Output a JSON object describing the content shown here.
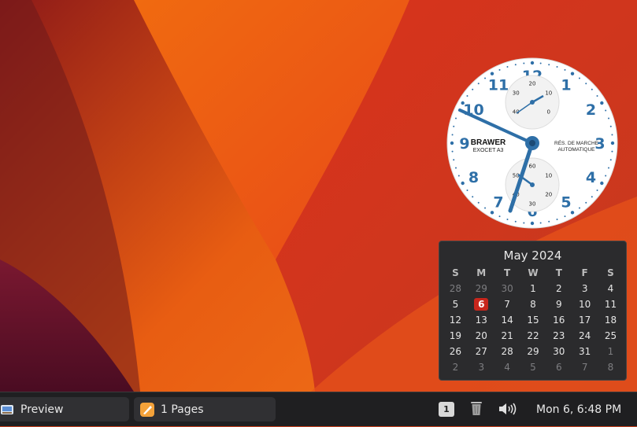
{
  "wallpaper": {
    "colors": [
      "#9a1e1a",
      "#f06b10",
      "#d8401c",
      "#6e1230"
    ]
  },
  "clock_widget": {
    "brand": "BRAWER",
    "model": "EXOCET A3",
    "right_text_1": "RÉS. DE MARCHE",
    "right_text_2": "AUTOMATIQUE",
    "hour_numerals": [
      "12",
      "1",
      "2",
      "3",
      "4",
      "5",
      "6",
      "7",
      "8",
      "9",
      "10",
      "11"
    ],
    "upper_subdial_labels": [
      "20",
      "10",
      "0",
      "30",
      "40"
    ],
    "lower_subdial_labels": [
      "60",
      "10",
      "20",
      "30",
      "40",
      "50"
    ],
    "accent_color": "#2e6fa7"
  },
  "calendar": {
    "title": "May 2024",
    "weekdays": [
      "S",
      "M",
      "T",
      "W",
      "T",
      "F",
      "S"
    ],
    "weeks": [
      [
        {
          "d": "28",
          "dim": true
        },
        {
          "d": "29",
          "dim": true
        },
        {
          "d": "30",
          "dim": true
        },
        {
          "d": "1"
        },
        {
          "d": "2"
        },
        {
          "d": "3"
        },
        {
          "d": "4"
        }
      ],
      [
        {
          "d": "5"
        },
        {
          "d": "6",
          "today": true
        },
        {
          "d": "7"
        },
        {
          "d": "8"
        },
        {
          "d": "9"
        },
        {
          "d": "10"
        },
        {
          "d": "11"
        }
      ],
      [
        {
          "d": "12"
        },
        {
          "d": "13"
        },
        {
          "d": "14"
        },
        {
          "d": "15"
        },
        {
          "d": "16"
        },
        {
          "d": "17"
        },
        {
          "d": "18"
        }
      ],
      [
        {
          "d": "19"
        },
        {
          "d": "20"
        },
        {
          "d": "21"
        },
        {
          "d": "22"
        },
        {
          "d": "23"
        },
        {
          "d": "24"
        },
        {
          "d": "25"
        }
      ],
      [
        {
          "d": "26"
        },
        {
          "d": "27"
        },
        {
          "d": "28"
        },
        {
          "d": "29"
        },
        {
          "d": "30"
        },
        {
          "d": "31"
        },
        {
          "d": "1",
          "dim": true
        }
      ],
      [
        {
          "d": "2",
          "dim": true
        },
        {
          "d": "3",
          "dim": true
        },
        {
          "d": "4",
          "dim": true
        },
        {
          "d": "5",
          "dim": true
        },
        {
          "d": "6",
          "dim": true
        },
        {
          "d": "7",
          "dim": true
        },
        {
          "d": "8",
          "dim": true
        }
      ]
    ],
    "today_color": "#c8261c"
  },
  "taskbar": {
    "tasks": [
      {
        "label": "Preview",
        "icon": "preview-app-icon"
      },
      {
        "label": "1 Pages",
        "icon": "pages-app-icon"
      }
    ],
    "workspace_badge": "1",
    "trash_icon": "trash-icon",
    "volume_icon": "volume-icon",
    "datetime": "Mon 6, 6:48 PM"
  }
}
